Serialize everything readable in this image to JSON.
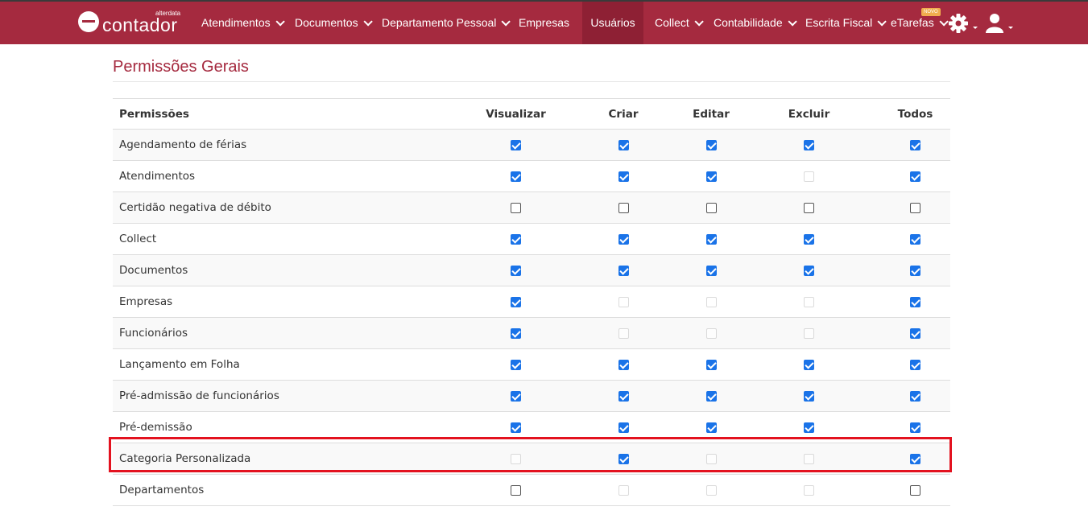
{
  "brand": {
    "small": "alterdata",
    "name": "contador"
  },
  "nav": {
    "items": [
      {
        "label": "Atendimentos",
        "dropdown": true
      },
      {
        "label": "Documentos",
        "dropdown": true
      },
      {
        "label": "Departamento Pessoal",
        "dropdown": true
      },
      {
        "label": "Empresas",
        "dropdown": false
      },
      {
        "label": "Usuários",
        "dropdown": false,
        "active": true
      },
      {
        "label": "Collect",
        "dropdown": true
      },
      {
        "label": "Contabilidade",
        "dropdown": true
      },
      {
        "label": "Escrita Fiscal",
        "dropdown": true
      },
      {
        "label": "eTarefas",
        "dropdown": true,
        "badge": "NOVO"
      }
    ],
    "settings_icon": "gear-icon",
    "user_icon": "user-icon"
  },
  "page": {
    "title": "Permissões Gerais"
  },
  "table": {
    "headers": [
      "Permissões",
      "Visualizar",
      "Criar",
      "Editar",
      "Excluir",
      "Todos"
    ],
    "rows": [
      {
        "label": "Agendamento de férias",
        "states": [
          "on",
          "on",
          "on",
          "on",
          "on"
        ]
      },
      {
        "label": "Atendimentos",
        "states": [
          "on",
          "on",
          "on",
          "dis",
          "on"
        ]
      },
      {
        "label": "Certidão negativa de débito",
        "states": [
          "off",
          "off",
          "off",
          "off",
          "off"
        ]
      },
      {
        "label": "Collect",
        "states": [
          "on",
          "on",
          "on",
          "on",
          "on"
        ]
      },
      {
        "label": "Documentos",
        "states": [
          "on",
          "on",
          "on",
          "on",
          "on"
        ]
      },
      {
        "label": "Empresas",
        "states": [
          "on",
          "dis",
          "dis",
          "dis",
          "on"
        ]
      },
      {
        "label": "Funcionários",
        "states": [
          "on",
          "dis",
          "dis",
          "dis",
          "on"
        ]
      },
      {
        "label": "Lançamento em Folha",
        "states": [
          "on",
          "on",
          "on",
          "on",
          "on"
        ]
      },
      {
        "label": "Pré-admissão de funcionários",
        "states": [
          "on",
          "on",
          "on",
          "on",
          "on"
        ]
      },
      {
        "label": "Pré-demissão",
        "states": [
          "on",
          "on",
          "on",
          "on",
          "on"
        ]
      },
      {
        "label": "Categoria Personalizada",
        "states": [
          "dis",
          "on",
          "dis",
          "dis",
          "on"
        ]
      },
      {
        "label": "Departamentos",
        "states": [
          "off",
          "dis",
          "dis",
          "dis",
          "off"
        ]
      }
    ]
  },
  "colors": {
    "navbar": "#a52a3f",
    "accent": "#a52a3f",
    "checkbox": "#1a73e8",
    "highlight": "#e3121f"
  }
}
